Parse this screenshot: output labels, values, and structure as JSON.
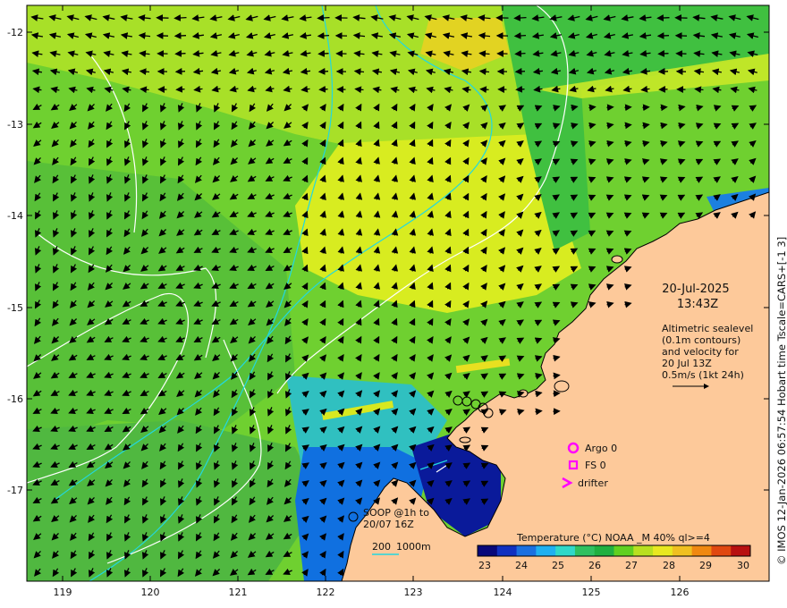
{
  "map": {
    "lon_ticks": [
      "119",
      "120",
      "121",
      "122",
      "123",
      "124",
      "125",
      "126"
    ],
    "lat_ticks": [
      "-12",
      "-13",
      "-14",
      "-15",
      "-16",
      "-17"
    ]
  },
  "datetime": {
    "date": "20-Jul-2025",
    "time": "13:43Z"
  },
  "altimetry_note": {
    "lines": [
      "Altimetric sealevel",
      "(0.1m contours)",
      "and velocity for",
      "20 Jul 13Z",
      "0.5m/s (1kt 24h)"
    ]
  },
  "legend": {
    "argo": "Argo 0",
    "fs": "FS 0",
    "drifter": "drifter",
    "argo_color": "#ff00ff"
  },
  "soop": {
    "line1": "SOOP @1h to",
    "line2": "20/07 16Z"
  },
  "isobath": {
    "label1": "200",
    "label2": "1000m"
  },
  "colorbar": {
    "title": "Temperature (°C) NOAA _M 40% ql>=4",
    "ticks": [
      "23",
      "24",
      "25",
      "26",
      "27",
      "28",
      "29",
      "30"
    ],
    "colors": [
      "#08087a",
      "#1030c0",
      "#1b70e0",
      "#20b0f0",
      "#30d8c8",
      "#30c060",
      "#20b040",
      "#60d020",
      "#b8e020",
      "#e8e820",
      "#f0c020",
      "#f08810",
      "#e04810",
      "#b81010"
    ]
  },
  "credit": "© IMOS 12-Jan-2026 06:57:54 Hobart time Tscale=CARS+[-1 3]"
}
